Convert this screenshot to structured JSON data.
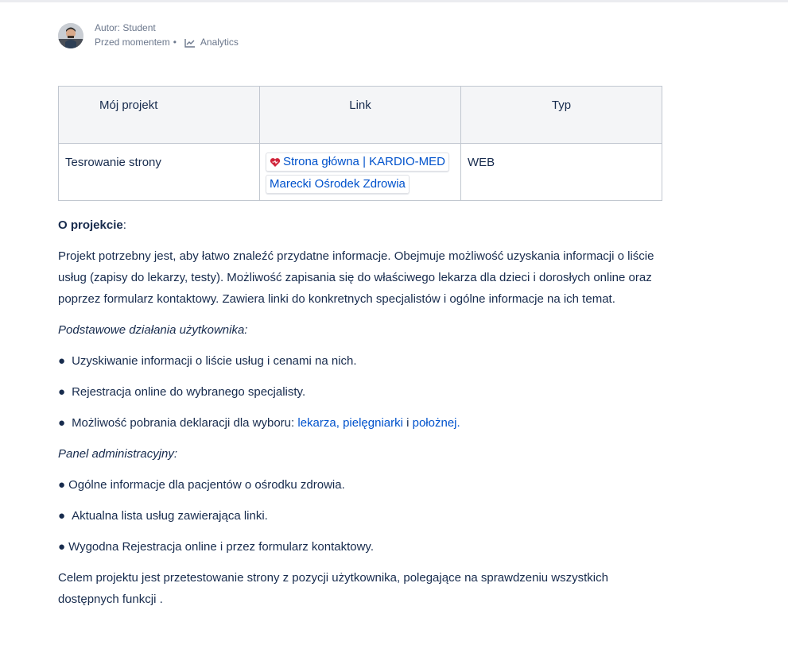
{
  "byline": {
    "author": "Autor: Student",
    "time": "Przed momentem",
    "separator": "•",
    "analytics": "Analytics"
  },
  "table": {
    "headers": [
      "Mój projekt",
      "Link",
      "Typ"
    ],
    "row": {
      "project": "Tesrowanie strony",
      "link1": "Strona główna | KARDIO-MED",
      "link2": "Marecki Ośrodek Zdrowia",
      "type": "WEB"
    }
  },
  "about": {
    "heading": "O projekcie",
    "colon": ":",
    "intro": "Projekt potrzebny jest, aby łatwo znaleźć przydatne informacje. Obejmuje możliwość uzyskania informacji o liście usług (zapisy do lekarzy, testy).  Możliwość zapisania się do właściwego lekarza dla dzieci i dorosłych online oraz poprzez formularz kontaktowy. Zawiera linki do konkretnych specjalistów i ogólne informacje na ich temat.",
    "user_actions_title": "Podstawowe działania użytkownika:",
    "user_actions": [
      "Uzyskiwanie informacji o liście usług i cenami na nich.",
      "Rejestracja online do wybranego specjalisty."
    ],
    "declaration_prefix": "Możliwość pobrania deklaracji dla wyboru: ",
    "declaration_links": [
      "lekarza",
      "pielęgniarki",
      "położnej"
    ],
    "declaration_sep1": ", ",
    "declaration_sep2": " i ",
    "declaration_end": ".",
    "admin_title": "Panel administracyjny:",
    "admin_items": [
      "Ogólne informacje dla pacjentów o ośrodku zdrowia.",
      "Aktualna lista usług zawierająca linki.",
      "Wygodna Rejestracja online i przez formularz kontaktowy."
    ],
    "goal": "Celem projektu jest przetestowanie strony z pozycji użytkownika, polegające na sprawdzeniu wszystkich dostępnych funkcji ."
  },
  "bullet_char": "●"
}
